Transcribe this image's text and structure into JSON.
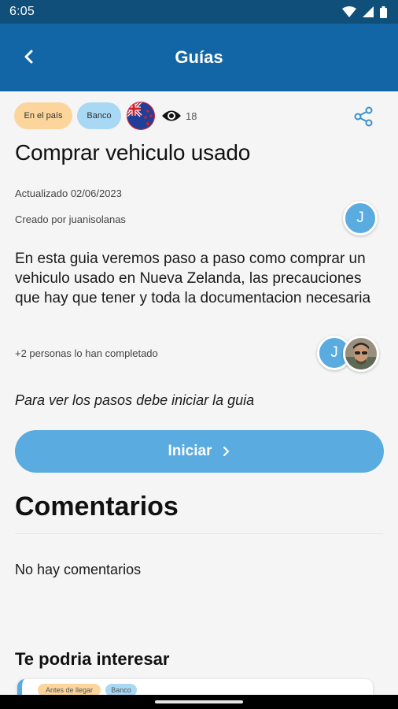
{
  "status_bar": {
    "time": "6:05"
  },
  "app_bar": {
    "title": "Guías",
    "back_icon": "arrow-back-icon"
  },
  "guide": {
    "tags": [
      "En el país",
      "Banco"
    ],
    "views": "18",
    "title": "Comprar vehiculo usado",
    "updated": "Actualizado 02/06/2023",
    "creator": "Creado por juanisolanas",
    "creator_initial": "J",
    "description": "En esta guia veremos paso a paso como comprar un vehiculo usado en Nueva Zelanda, las precauciones que hay que tener y toda la documentacion necesaria",
    "completed": "+2 personas lo han completado",
    "completer_initial": "J",
    "hint": "Para ver los pasos debe iniciar la guia",
    "start_label": "Iniciar"
  },
  "comments": {
    "title": "Comentarios",
    "empty": "No hay comentarios"
  },
  "related": {
    "title": "Te podria interesar",
    "card_tags": [
      "Antes de llegar",
      "Banco"
    ]
  },
  "colors": {
    "primary": "#1366a5",
    "status": "#0f4f79",
    "accent": "#5aabdf",
    "tag_orange": "#fbd59b",
    "tag_blue": "#a8d8f3"
  }
}
